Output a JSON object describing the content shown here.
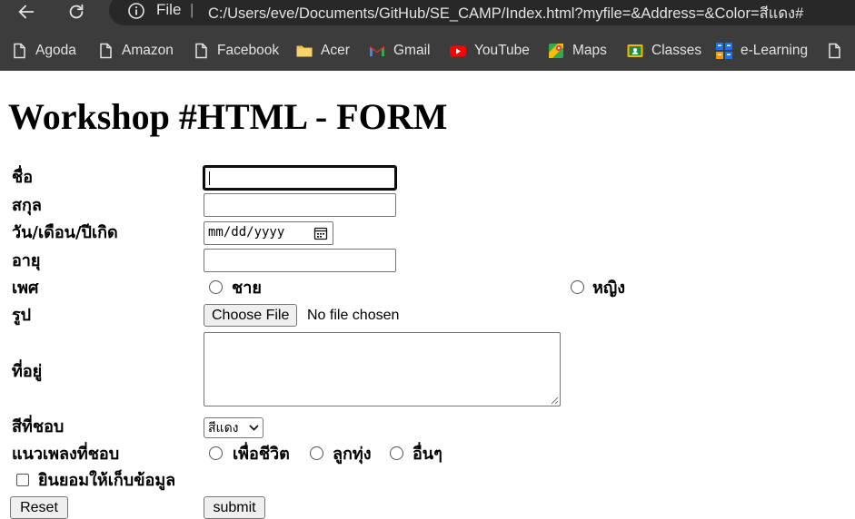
{
  "browser": {
    "nav": {
      "back_icon": "back-arrow-icon",
      "reload_icon": "reload-icon"
    },
    "omnibox": {
      "info_icon": "info-icon",
      "scheme_label": "File",
      "separator": "|",
      "url": "C:/Users/eve/Documents/GitHub/SE_CAMP/Index.html?myfile=&Address=&Color=สีแดง#"
    },
    "bookmarks": [
      {
        "label": "Agoda",
        "icon": "page-icon"
      },
      {
        "label": "Amazon",
        "icon": "page-icon"
      },
      {
        "label": "Facebook",
        "icon": "page-icon"
      },
      {
        "label": "Acer",
        "icon": "folder-icon"
      },
      {
        "label": "Gmail",
        "icon": "gmail-icon"
      },
      {
        "label": "YouTube",
        "icon": "youtube-icon"
      },
      {
        "label": "Maps",
        "icon": "maps-icon"
      },
      {
        "label": "Classes",
        "icon": "classes-icon"
      },
      {
        "label": "e-Learning",
        "icon": "elearning-icon"
      },
      {
        "label": "",
        "icon": "page-icon"
      }
    ],
    "colors": {
      "chrome_bg": "#3c3c3c",
      "omnibox_bg": "#282828",
      "chrome_text": "#e3e3e3"
    }
  },
  "page": {
    "title": "Workshop #HTML - FORM",
    "form": {
      "first_name": {
        "label": "ชื่อ",
        "value": ""
      },
      "last_name": {
        "label": "สกุล",
        "value": ""
      },
      "birthdate": {
        "label": "วัน/เดือน/ปีเกิด",
        "placeholder": "mm/dd/yyyy",
        "icon": "calendar-icon"
      },
      "age": {
        "label": "อายุ",
        "value": ""
      },
      "gender": {
        "label": "เพศ",
        "options": [
          "ชาย",
          "หญิง"
        ],
        "selected": null
      },
      "photo": {
        "label": "รูป",
        "button_label": "Choose File",
        "status": "No file chosen"
      },
      "address": {
        "label": "ที่อยู่",
        "value": ""
      },
      "favorite_color": {
        "label": "สีที่ชอบ",
        "selected": "สีแดง"
      },
      "music_genre": {
        "label": "แนวเพลงที่ชอบ",
        "options": [
          "เพื่อชีวิต",
          "ลูกทุ่ง",
          "อื่นๆ"
        ],
        "selected": null
      },
      "consent": {
        "label": "ยินยอมให้เก็บข้อมูล",
        "checked": false
      },
      "reset_label": "Reset",
      "submit_label": "submit"
    }
  }
}
